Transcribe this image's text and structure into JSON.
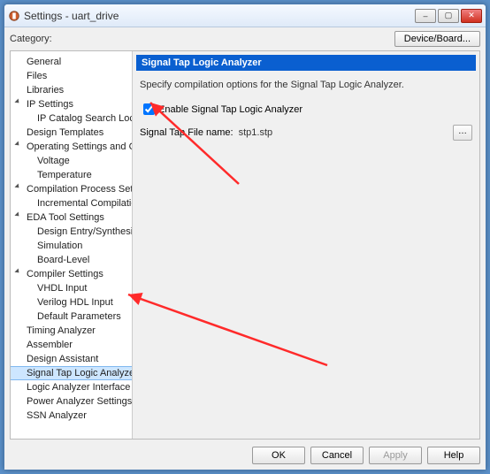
{
  "window": {
    "title": "Settings - uart_drive"
  },
  "toprow": {
    "category_label": "Category:",
    "device_btn": "Device/Board..."
  },
  "tree": {
    "items": [
      {
        "label": "General"
      },
      {
        "label": "Files"
      },
      {
        "label": "Libraries"
      },
      {
        "label": "IP Settings",
        "expandable": true
      },
      {
        "label": "IP Catalog Search Locations",
        "child": true
      },
      {
        "label": "Design Templates"
      },
      {
        "label": "Operating Settings and Conditions",
        "expandable": true
      },
      {
        "label": "Voltage",
        "child": true
      },
      {
        "label": "Temperature",
        "child": true
      },
      {
        "label": "Compilation Process Settings",
        "expandable": true
      },
      {
        "label": "Incremental Compilation",
        "child": true
      },
      {
        "label": "EDA Tool Settings",
        "expandable": true
      },
      {
        "label": "Design Entry/Synthesis",
        "child": true
      },
      {
        "label": "Simulation",
        "child": true
      },
      {
        "label": "Board-Level",
        "child": true
      },
      {
        "label": "Compiler Settings",
        "expandable": true
      },
      {
        "label": "VHDL Input",
        "child": true
      },
      {
        "label": "Verilog HDL Input",
        "child": true
      },
      {
        "label": "Default Parameters",
        "child": true
      },
      {
        "label": "Timing Analyzer"
      },
      {
        "label": "Assembler"
      },
      {
        "label": "Design Assistant"
      },
      {
        "label": "Signal Tap Logic Analyzer",
        "selected": true
      },
      {
        "label": "Logic Analyzer Interface"
      },
      {
        "label": "Power Analyzer Settings"
      },
      {
        "label": "SSN Analyzer"
      }
    ]
  },
  "panel": {
    "header": "Signal Tap Logic Analyzer",
    "description": "Specify compilation options for the Signal Tap Logic Analyzer.",
    "enable_label": "Enable Signal Tap Logic Analyzer",
    "enable_checked": true,
    "file_label": "Signal Tap File name:",
    "file_value": "stp1.stp"
  },
  "buttons": {
    "ok": "OK",
    "cancel": "Cancel",
    "apply": "Apply",
    "help": "Help"
  }
}
